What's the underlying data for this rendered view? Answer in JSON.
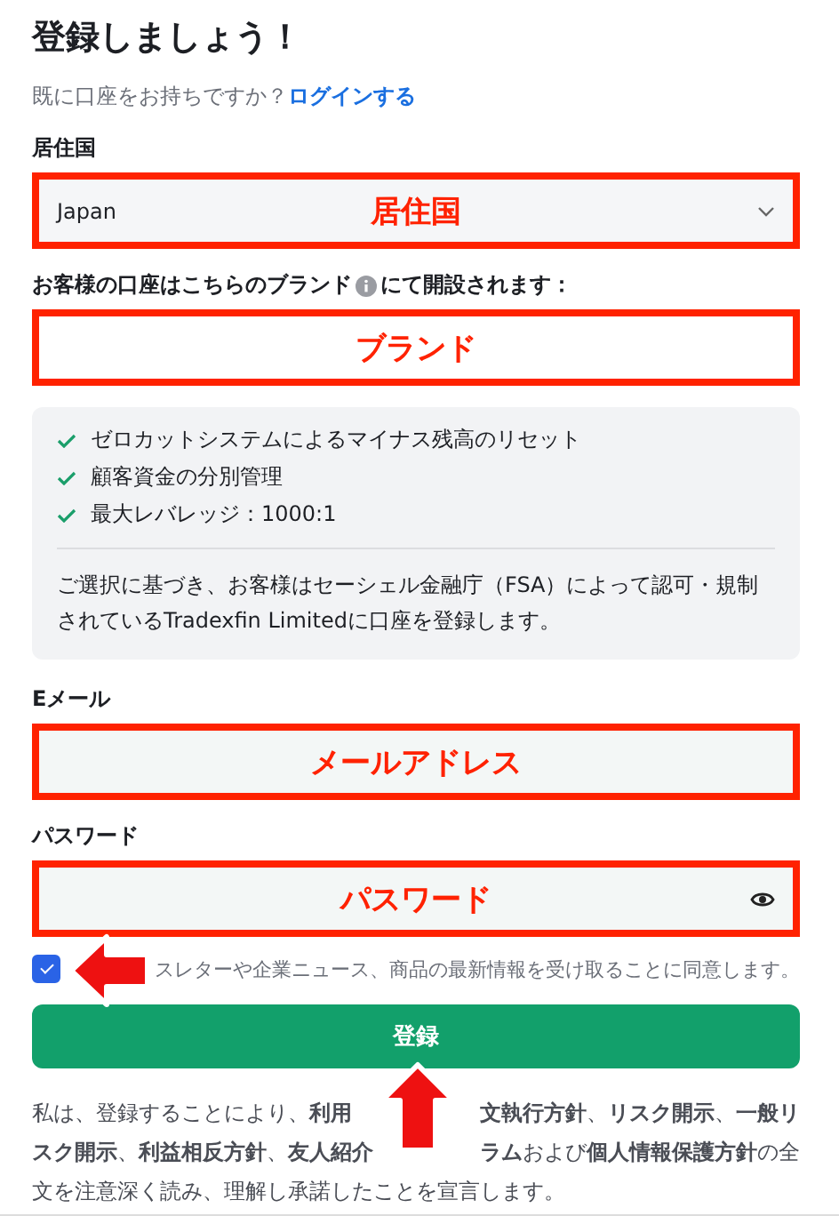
{
  "title": "登録しましょう！",
  "login_prompt": {
    "text": "既に口座をお持ちですか？",
    "link": "ログインする"
  },
  "country": {
    "label": "居住国",
    "value": "Japan",
    "annotation": "居住国"
  },
  "brand": {
    "label_before": "お客様の口座はこちらのブランド",
    "label_after": "にて開設されます：",
    "annotation": "ブランド"
  },
  "features": [
    "ゼロカットシステムによるマイナス残高のリセット",
    "顧客資金の分別管理",
    "最大レバレッジ：1000:1"
  ],
  "notice": "ご選択に基づき、お客様はセーシェル金融庁（FSA）によって認可・規制されているTradexfin Limitedに口座を登録します。",
  "email": {
    "label": "Eメール",
    "annotation": "メールアドレス"
  },
  "password": {
    "label": "パスワード",
    "annotation": "パスワード"
  },
  "consent": {
    "checked": true,
    "text": "スレターや企業ニュース、商品の最新情報を受け取ることに同意します。"
  },
  "submit": "登録",
  "legal_lines": [
    [
      "私は、登録することにより、**利用**",
      "**文執行方針**、**リスク開示**、**一般リ**"
    ],
    [
      "**スク開示**、**利益相反方針**、**友人紹介**",
      "**ラム**および**個人情報保護方針**の全"
    ],
    [
      "文を注意深く読み、理解し承諾したことを宣言します。"
    ]
  ]
}
